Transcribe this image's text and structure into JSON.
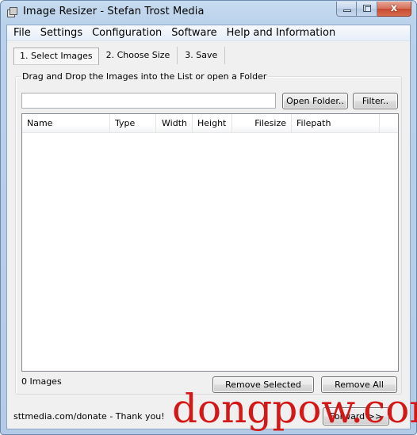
{
  "window": {
    "title": "Image Resizer - Stefan Trost Media",
    "app_icon": "app-window-icon",
    "controls": {
      "minimize_icon": "minimize-icon",
      "maximize_icon": "maximize-icon",
      "close_icon": "close-icon",
      "close_glyph": "x"
    }
  },
  "menubar": {
    "items": [
      {
        "label": "File"
      },
      {
        "label": "Settings"
      },
      {
        "label": "Configuration"
      },
      {
        "label": "Software"
      },
      {
        "label": "Help and Information"
      }
    ]
  },
  "tabs": [
    {
      "label": "1. Select Images",
      "active": true
    },
    {
      "label": "2. Choose Size",
      "active": false
    },
    {
      "label": "3. Save",
      "active": false
    }
  ],
  "select_images": {
    "group_caption": "Drag and Drop the Images into the List or open a Folder",
    "path_input": {
      "value": "",
      "placeholder": ""
    },
    "open_folder_label": "Open Folder..",
    "filter_label": "Filter..",
    "list": {
      "columns": [
        {
          "label": "Name",
          "align": "left"
        },
        {
          "label": "Type",
          "align": "left"
        },
        {
          "label": "Width",
          "align": "right"
        },
        {
          "label": "Height",
          "align": "left"
        },
        {
          "label": "Filesize",
          "align": "right"
        },
        {
          "label": "Filepath",
          "align": "left"
        },
        {
          "label": "",
          "align": "left"
        }
      ],
      "rows": []
    },
    "count_label": "0 Images",
    "remove_selected_label": "Remove Selected",
    "remove_all_label": "Remove All"
  },
  "footer": {
    "donate_text": "sttmedia.com/donate - Thank you!",
    "forward_label": "Forward >>"
  },
  "watermark": {
    "text": "dongpow.com",
    "color": "#d41818"
  },
  "colors": {
    "frame": "#b9d1ea",
    "client_bg": "#f0f0f0",
    "close_button": "#c74a30"
  }
}
